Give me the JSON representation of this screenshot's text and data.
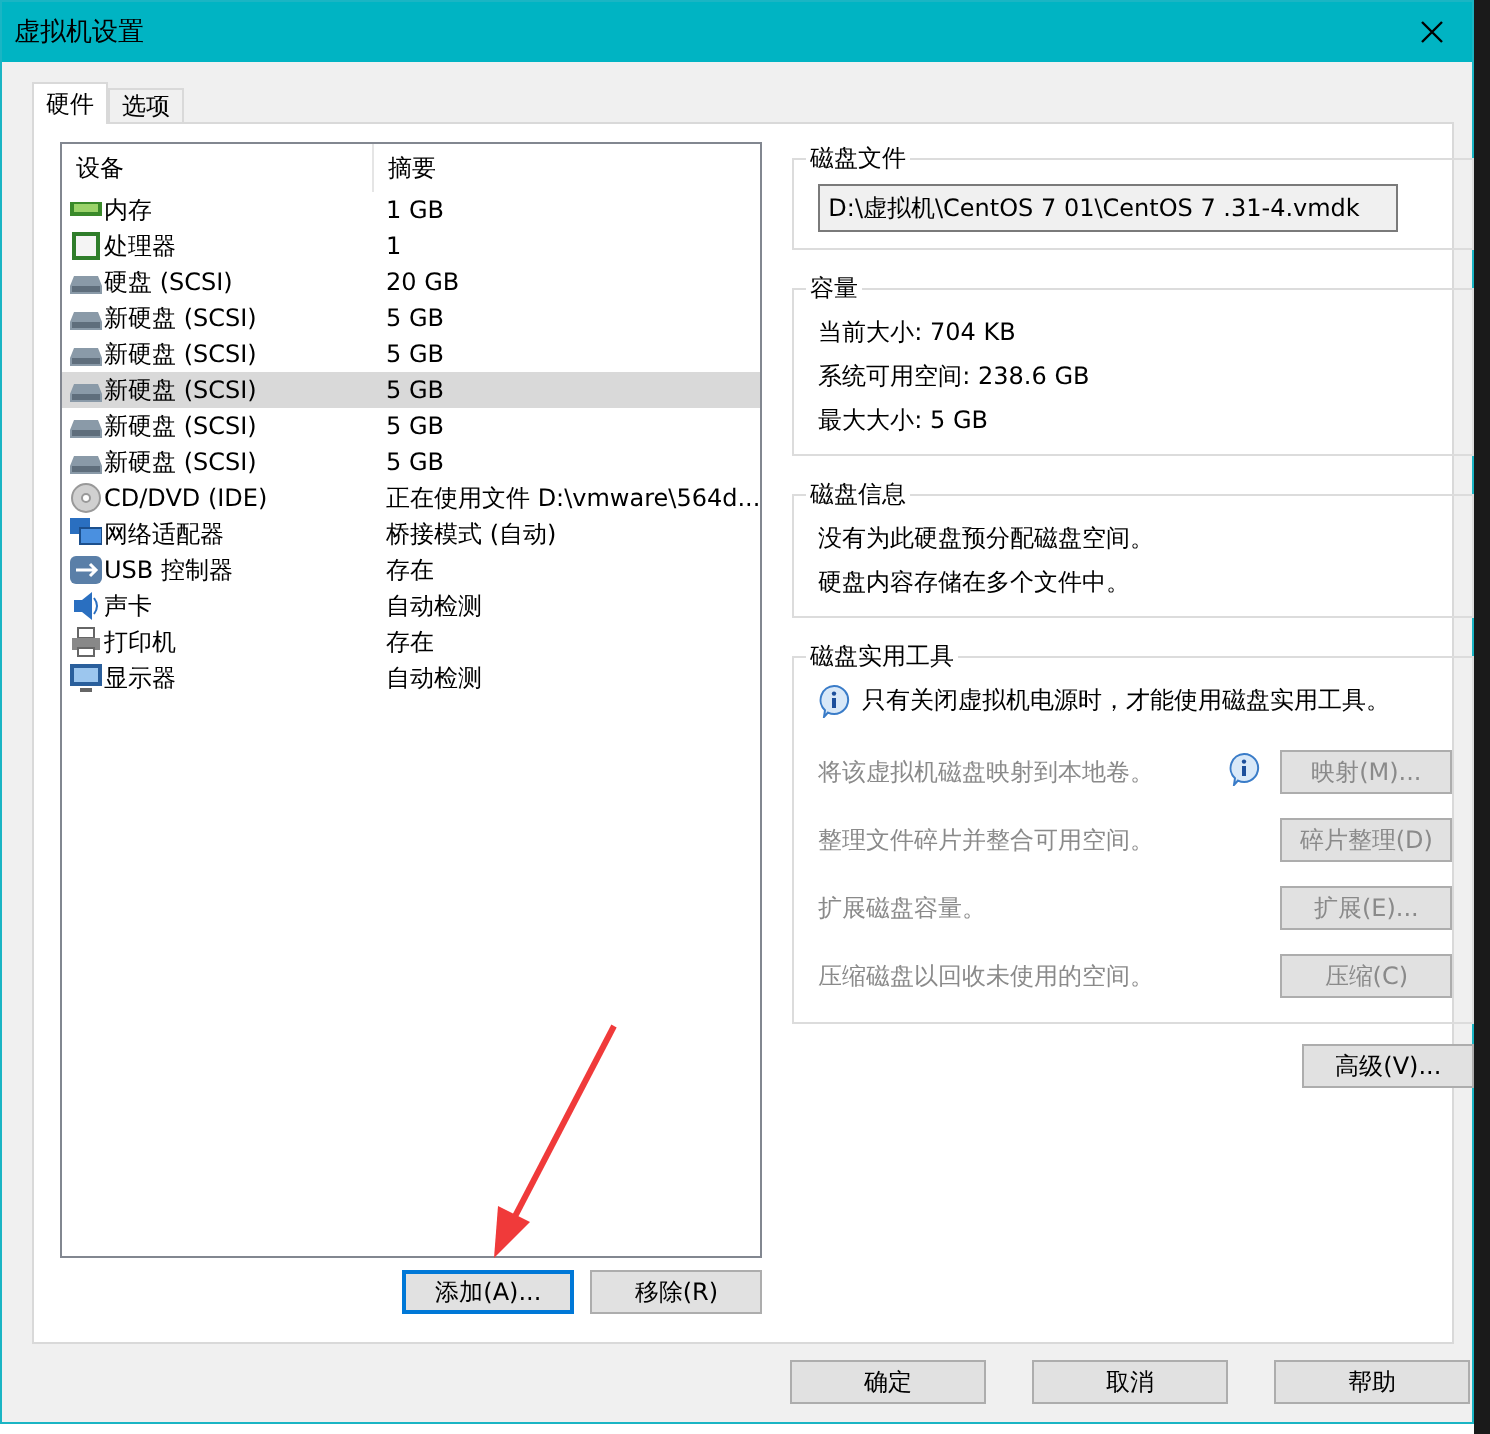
{
  "window": {
    "title": "虚拟机设置"
  },
  "tabs": [
    {
      "label": "硬件",
      "selected": true
    },
    {
      "label": "选项",
      "selected": false
    }
  ],
  "device_table": {
    "columns": [
      "设备",
      "摘要"
    ],
    "rows": [
      {
        "kind": "memory",
        "device": "内存",
        "summary": "1 GB",
        "selected": false
      },
      {
        "kind": "cpu",
        "device": "处理器",
        "summary": "1",
        "selected": false
      },
      {
        "kind": "disk",
        "device": "硬盘 (SCSI)",
        "summary": "20 GB",
        "selected": false
      },
      {
        "kind": "disk",
        "device": "新硬盘 (SCSI)",
        "summary": "5 GB",
        "selected": false
      },
      {
        "kind": "disk",
        "device": "新硬盘 (SCSI)",
        "summary": "5 GB",
        "selected": false
      },
      {
        "kind": "disk",
        "device": "新硬盘 (SCSI)",
        "summary": "5 GB",
        "selected": true
      },
      {
        "kind": "disk",
        "device": "新硬盘 (SCSI)",
        "summary": "5 GB",
        "selected": false
      },
      {
        "kind": "disk",
        "device": "新硬盘 (SCSI)",
        "summary": "5 GB",
        "selected": false
      },
      {
        "kind": "cdrom",
        "device": "CD/DVD (IDE)",
        "summary": "正在使用文件 D:\\vmware\\564d...",
        "selected": false
      },
      {
        "kind": "network",
        "device": "网络适配器",
        "summary": "桥接模式 (自动)",
        "selected": false
      },
      {
        "kind": "usb",
        "device": "USB 控制器",
        "summary": "存在",
        "selected": false
      },
      {
        "kind": "sound",
        "device": "声卡",
        "summary": "自动检测",
        "selected": false
      },
      {
        "kind": "printer",
        "device": "打印机",
        "summary": "存在",
        "selected": false
      },
      {
        "kind": "display",
        "device": "显示器",
        "summary": "自动检测",
        "selected": false
      }
    ]
  },
  "device_buttons": [
    {
      "label": "添加(A)...",
      "focused": true
    },
    {
      "label": "移除(R)",
      "focused": false
    }
  ],
  "disk_file": {
    "title": "磁盘文件",
    "value": "D:\\虚拟机\\CentOS 7 01\\CentOS 7 .31-4.vmdk"
  },
  "capacity": {
    "title": "容量",
    "lines": [
      "当前大小: 704 KB",
      "系统可用空间: 238.6 GB",
      "最大大小: 5 GB"
    ]
  },
  "disk_info": {
    "title": "磁盘信息",
    "lines": [
      "没有为此硬盘预分配磁盘空间。",
      "硬盘内容存储在多个文件中。"
    ]
  },
  "utilities": {
    "title": "磁盘实用工具",
    "notice": "只有关闭虚拟机电源时，才能使用磁盘实用工具。",
    "rows": [
      {
        "description": "将该虚拟机磁盘映射到本地卷。",
        "button": "映射(M)...",
        "info_icon": true,
        "disabled": true
      },
      {
        "description": "整理文件碎片并整合可用空间。",
        "button": "碎片整理(D)",
        "info_icon": false,
        "disabled": true
      },
      {
        "description": "扩展磁盘容量。",
        "button": "扩展(E)...",
        "info_icon": false,
        "disabled": true
      },
      {
        "description": "压缩磁盘以回收未使用的空间。",
        "button": "压缩(C)",
        "info_icon": false,
        "disabled": true
      }
    ]
  },
  "advanced_button": "高级(V)...",
  "dialog_buttons": [
    "确定",
    "取消",
    "帮助"
  ]
}
